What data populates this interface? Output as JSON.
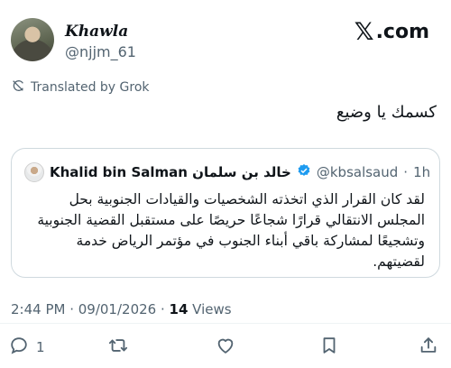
{
  "author": {
    "display_name": "Khawla",
    "handle": "@njjm_61"
  },
  "brand": {
    "logo_mark": "𝕏",
    "logo_domain": ".com"
  },
  "translation": {
    "label": "Translated by Grok",
    "icon": "translate-icon"
  },
  "tweet": {
    "text": "كسمك يا وضيع"
  },
  "quoted": {
    "name": "Khalid bin Salman خالد بن سلمان",
    "handle": "@kbsalsaud",
    "separator": "·",
    "time": "1h",
    "body": "لقد كان القرار الذي اتخذته الشخصيات والقيادات الجنوبية بحل المجلس الانتقالي قرارًا شجاعًا حريصًا على مستقبل القضية الجنوبية وتشجيعًا لمشاركة باقي أبناء الجنوب في مؤتمر الرياض خدمة لقضيتهم."
  },
  "meta": {
    "timestamp": "2:44 PM · 09/01/2026 · ",
    "views_count": "14",
    "views_label": " Views"
  },
  "actions": {
    "reply_count": "1",
    "retweet_icon": "retweet-icon",
    "like_icon": "heart-icon",
    "bookmark_icon": "bookmark-icon",
    "share_icon": "share-icon"
  },
  "colors": {
    "text": "#0f1419",
    "muted": "#536471",
    "border": "#cfd9de",
    "verified": "#1d9bf0"
  }
}
